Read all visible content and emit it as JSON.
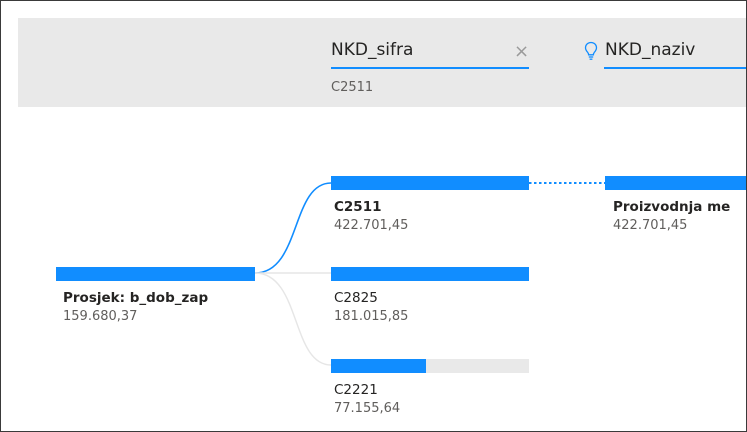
{
  "colors": {
    "accent": "#118dff",
    "track": "#e9e9e9",
    "header_bg": "#e9e9e9"
  },
  "header": {
    "levels": [
      {
        "title": "NKD_sifra",
        "selected": "C2511",
        "icon": "close-icon"
      },
      {
        "title": "NKD_naziv",
        "icon": "lightbulb-icon"
      }
    ],
    "close_glyph": "×"
  },
  "tree": {
    "root": {
      "label": "Prosjek: b_dob_zap",
      "value": "159.680,37",
      "fill_fraction": 1.0
    },
    "level1": [
      {
        "label": "C2511",
        "value": "422.701,45",
        "fill_fraction": 1.0,
        "selected": true
      },
      {
        "label": "C2825",
        "value": "181.015,85",
        "fill_fraction": 1.0,
        "selected": false
      },
      {
        "label": "C2221",
        "value": "77.155,64",
        "fill_fraction": 0.48,
        "selected": false
      }
    ],
    "level2": [
      {
        "label": "Proizvodnja me",
        "value": "422.701,45",
        "fill_fraction": 1.0
      }
    ]
  }
}
